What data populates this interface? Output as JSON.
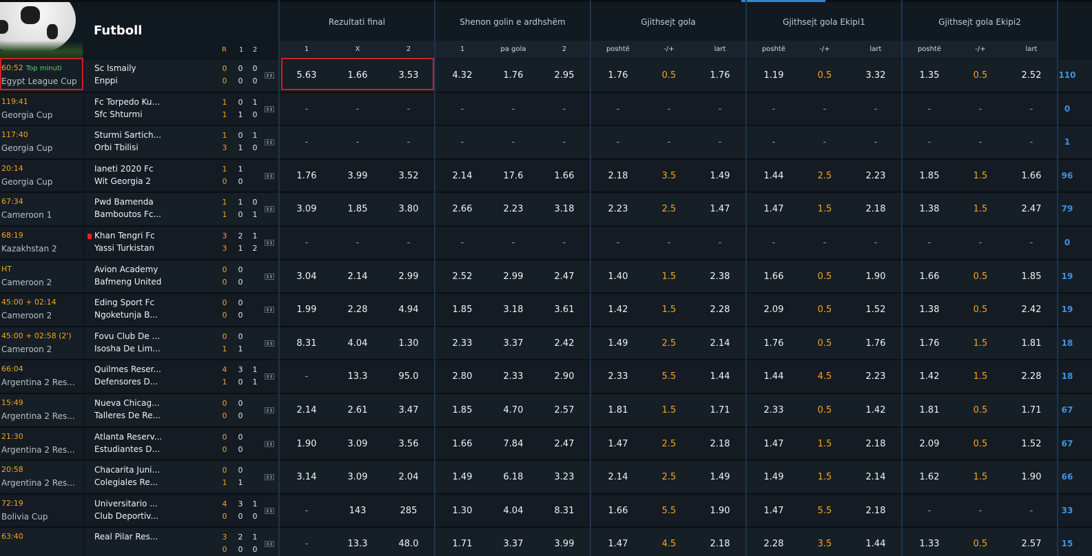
{
  "header": {
    "sport_title": "Futboll",
    "score_cols": {
      "r": "R",
      "one": "1",
      "two": "2"
    },
    "groups": [
      {
        "title": "Rezultati final",
        "subs": [
          "1",
          "X",
          "2"
        ]
      },
      {
        "title": "Shenon golin e ardhshëm",
        "subs": [
          "1",
          "pa gola",
          "2"
        ]
      },
      {
        "title": "Gjithsejt gola",
        "subs": [
          "poshtë",
          "-/+",
          "lart"
        ]
      },
      {
        "title": "Gjithsejt gola Ekipi1",
        "subs": [
          "poshtë",
          "-/+",
          "lart"
        ]
      },
      {
        "title": "Gjithsejt gola Ekipi2",
        "subs": [
          "poshtë",
          "-/+",
          "lart"
        ]
      }
    ]
  },
  "matches": [
    {
      "time": "60:52",
      "tag": "Top minuti",
      "league": "Egypt League Cup",
      "team1": "Sc Ismaily",
      "team2": "Enppi",
      "redcard": false,
      "s1": [
        "0",
        "0",
        "0"
      ],
      "s2": [
        "0",
        "0",
        "0"
      ],
      "odds": [
        [
          "5.63",
          "1.66",
          "3.53"
        ],
        [
          "4.32",
          "1.76",
          "2.95"
        ],
        [
          "1.76",
          "0.5",
          "1.76"
        ],
        [
          "1.19",
          "0.5",
          "3.32"
        ],
        [
          "1.35",
          "0.5",
          "2.52"
        ]
      ],
      "count": "110"
    },
    {
      "time": "119:41",
      "tag": "",
      "league": "Georgia Cup",
      "team1": "Fc Torpedo Ku...",
      "team2": "Sfc Shturmi",
      "redcard": false,
      "s1": [
        "1",
        "0",
        "1"
      ],
      "s2": [
        "1",
        "1",
        "0"
      ],
      "odds": [
        [
          "-",
          "-",
          "-"
        ],
        [
          "-",
          "-",
          "-"
        ],
        [
          "-",
          "-",
          "-"
        ],
        [
          "-",
          "-",
          "-"
        ],
        [
          "-",
          "-",
          "-"
        ]
      ],
      "count": "0"
    },
    {
      "time": "117:40",
      "tag": "",
      "league": "Georgia Cup",
      "team1": "Sturmi Sartich...",
      "team2": "Orbi Tbilisi",
      "redcard": false,
      "s1": [
        "1",
        "0",
        "1"
      ],
      "s2": [
        "3",
        "1",
        "0"
      ],
      "odds": [
        [
          "-",
          "-",
          "-"
        ],
        [
          "-",
          "-",
          "-"
        ],
        [
          "-",
          "-",
          "-"
        ],
        [
          "-",
          "-",
          "-"
        ],
        [
          "-",
          "-",
          "-"
        ]
      ],
      "count": "1"
    },
    {
      "time": "20:14",
      "tag": "",
      "league": "Georgia Cup",
      "team1": "Ianeti 2020 Fc",
      "team2": "Wit Georgia 2",
      "redcard": false,
      "s1": [
        "1",
        "1",
        ""
      ],
      "s2": [
        "0",
        "0",
        ""
      ],
      "odds": [
        [
          "1.76",
          "3.99",
          "3.52"
        ],
        [
          "2.14",
          "17.6",
          "1.66"
        ],
        [
          "2.18",
          "3.5",
          "1.49"
        ],
        [
          "1.44",
          "2.5",
          "2.23"
        ],
        [
          "1.85",
          "1.5",
          "1.66"
        ]
      ],
      "count": "96"
    },
    {
      "time": "67:34",
      "tag": "",
      "league": "Cameroon 1",
      "team1": "Pwd Bamenda",
      "team2": "Bamboutos Fc...",
      "redcard": false,
      "s1": [
        "1",
        "1",
        "0"
      ],
      "s2": [
        "1",
        "0",
        "1"
      ],
      "odds": [
        [
          "3.09",
          "1.85",
          "3.80"
        ],
        [
          "2.66",
          "2.23",
          "3.18"
        ],
        [
          "2.23",
          "2.5",
          "1.47"
        ],
        [
          "1.47",
          "1.5",
          "2.18"
        ],
        [
          "1.38",
          "1.5",
          "2.47"
        ]
      ],
      "count": "79"
    },
    {
      "time": "68:19",
      "tag": "",
      "league": "Kazakhstan 2",
      "team1": "Khan Tengri Fc",
      "team2": "Yassi Turkistan",
      "redcard": true,
      "s1": [
        "3",
        "2",
        "1"
      ],
      "s2": [
        "3",
        "1",
        "2"
      ],
      "odds": [
        [
          "-",
          "-",
          "-"
        ],
        [
          "-",
          "-",
          "-"
        ],
        [
          "-",
          "-",
          "-"
        ],
        [
          "-",
          "-",
          "-"
        ],
        [
          "-",
          "-",
          "-"
        ]
      ],
      "count": "0"
    },
    {
      "time": "HT",
      "tag": "",
      "league": "Cameroon 2",
      "team1": "Avion Academy",
      "team2": "Bafmeng United",
      "redcard": false,
      "s1": [
        "0",
        "0",
        ""
      ],
      "s2": [
        "0",
        "0",
        ""
      ],
      "odds": [
        [
          "3.04",
          "2.14",
          "2.99"
        ],
        [
          "2.52",
          "2.99",
          "2.47"
        ],
        [
          "1.40",
          "1.5",
          "2.38"
        ],
        [
          "1.66",
          "0.5",
          "1.90"
        ],
        [
          "1.66",
          "0.5",
          "1.85"
        ]
      ],
      "count": "19"
    },
    {
      "time": "45:00 + 02:14",
      "tag": "",
      "league": "Cameroon 2",
      "team1": "Eding Sport Fc",
      "team2": "Ngoketunja B...",
      "redcard": false,
      "s1": [
        "0",
        "0",
        ""
      ],
      "s2": [
        "0",
        "0",
        ""
      ],
      "odds": [
        [
          "1.99",
          "2.28",
          "4.94"
        ],
        [
          "1.85",
          "3.18",
          "3.61"
        ],
        [
          "1.42",
          "1.5",
          "2.28"
        ],
        [
          "2.09",
          "0.5",
          "1.52"
        ],
        [
          "1.38",
          "0.5",
          "2.42"
        ]
      ],
      "count": "19"
    },
    {
      "time": "45:00 + 02:58 (2')",
      "tag": "",
      "league": "Cameroon 2",
      "team1": "Fovu Club De ...",
      "team2": "Isosha De Lim...",
      "redcard": false,
      "s1": [
        "0",
        "0",
        ""
      ],
      "s2": [
        "1",
        "1",
        ""
      ],
      "odds": [
        [
          "8.31",
          "4.04",
          "1.30"
        ],
        [
          "2.33",
          "3.37",
          "2.42"
        ],
        [
          "1.49",
          "2.5",
          "2.14"
        ],
        [
          "1.76",
          "0.5",
          "1.76"
        ],
        [
          "1.76",
          "1.5",
          "1.81"
        ]
      ],
      "count": "18"
    },
    {
      "time": "66:04",
      "tag": "",
      "league": "Argentina 2 Res...",
      "team1": "Quilmes Reser...",
      "team2": "Defensores D...",
      "redcard": false,
      "s1": [
        "4",
        "3",
        "1"
      ],
      "s2": [
        "1",
        "0",
        "1"
      ],
      "odds": [
        [
          "-",
          "13.3",
          "95.0"
        ],
        [
          "2.80",
          "2.33",
          "2.90"
        ],
        [
          "2.33",
          "5.5",
          "1.44"
        ],
        [
          "1.44",
          "4.5",
          "2.23"
        ],
        [
          "1.42",
          "1.5",
          "2.28"
        ]
      ],
      "count": "18"
    },
    {
      "time": "15:49",
      "tag": "",
      "league": "Argentina 2 Res...",
      "team1": "Nueva Chicag...",
      "team2": "Talleres De Re...",
      "redcard": false,
      "s1": [
        "0",
        "0",
        ""
      ],
      "s2": [
        "0",
        "0",
        ""
      ],
      "odds": [
        [
          "2.14",
          "2.61",
          "3.47"
        ],
        [
          "1.85",
          "4.70",
          "2.57"
        ],
        [
          "1.81",
          "1.5",
          "1.71"
        ],
        [
          "2.33",
          "0.5",
          "1.42"
        ],
        [
          "1.81",
          "0.5",
          "1.71"
        ]
      ],
      "count": "67"
    },
    {
      "time": "21:30",
      "tag": "",
      "league": "Argentina 2 Res...",
      "team1": "Atlanta Reserv...",
      "team2": "Estudiantes D...",
      "redcard": false,
      "s1": [
        "0",
        "0",
        ""
      ],
      "s2": [
        "0",
        "0",
        ""
      ],
      "odds": [
        [
          "1.90",
          "3.09",
          "3.56"
        ],
        [
          "1.66",
          "7.84",
          "2.47"
        ],
        [
          "1.47",
          "2.5",
          "2.18"
        ],
        [
          "1.47",
          "1.5",
          "2.18"
        ],
        [
          "2.09",
          "0.5",
          "1.52"
        ]
      ],
      "count": "67"
    },
    {
      "time": "20:58",
      "tag": "",
      "league": "Argentina 2 Res...",
      "team1": "Chacarita Juni...",
      "team2": "Colegiales Re...",
      "redcard": false,
      "s1": [
        "0",
        "0",
        ""
      ],
      "s2": [
        "1",
        "1",
        ""
      ],
      "odds": [
        [
          "3.14",
          "3.09",
          "2.04"
        ],
        [
          "1.49",
          "6.18",
          "3.23"
        ],
        [
          "2.14",
          "2.5",
          "1.49"
        ],
        [
          "1.49",
          "1.5",
          "2.14"
        ],
        [
          "1.62",
          "1.5",
          "1.90"
        ]
      ],
      "count": "66"
    },
    {
      "time": "72:19",
      "tag": "",
      "league": "Bolivia Cup",
      "team1": "Universitario ...",
      "team2": "Club Deportiv...",
      "redcard": false,
      "s1": [
        "4",
        "3",
        "1"
      ],
      "s2": [
        "0",
        "0",
        "0"
      ],
      "odds": [
        [
          "-",
          "143",
          "285"
        ],
        [
          "1.30",
          "4.04",
          "8.31"
        ],
        [
          "1.66",
          "5.5",
          "1.90"
        ],
        [
          "1.47",
          "5.5",
          "2.18"
        ],
        [
          "-",
          "-",
          "-"
        ]
      ],
      "count": "33"
    },
    {
      "time": "63:40",
      "tag": "",
      "league": "",
      "team1": "Real Pilar Res...",
      "team2": "",
      "redcard": false,
      "s1": [
        "3",
        "2",
        "1"
      ],
      "s2": [
        "0",
        "0",
        "0"
      ],
      "odds": [
        [
          "-",
          "13.3",
          "48.0"
        ],
        [
          "1.71",
          "3.37",
          "3.99"
        ],
        [
          "1.47",
          "4.5",
          "2.18"
        ],
        [
          "2.28",
          "3.5",
          "1.44"
        ],
        [
          "1.33",
          "0.5",
          "2.57"
        ]
      ],
      "count": "15"
    }
  ],
  "colors": {
    "accent": "#2e87d8",
    "live_time": "#f5a623",
    "line_value": "#f5a623",
    "count": "#3d93e6",
    "highlight": "#d11f26",
    "top_tag": "#5ecf6d"
  },
  "icons": {
    "stats": "statistics-icon",
    "red_card": "red-card-icon",
    "sport": "football-icon"
  }
}
